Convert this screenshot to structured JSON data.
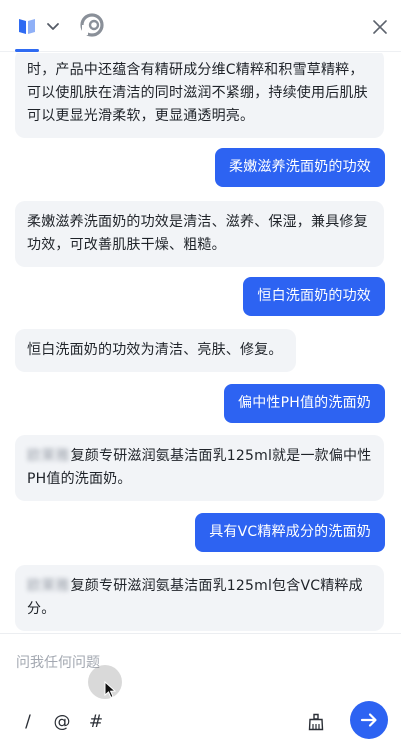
{
  "header": {
    "book_icon": "book-icon",
    "dropdown_icon": "chevron-down-icon",
    "logo_icon": "assistant-logo-icon",
    "close_icon": "close-icon"
  },
  "messages": [
    {
      "role": "assistant",
      "text": "时，产品中还蕴含有精研成分维C精粹和积雪草精粹，可以使肌肤在清洁的同时滋润不紧绷，持续使用后肌肤可以更显光滑柔软，更显通透明亮。"
    },
    {
      "role": "user",
      "text": "柔嫩滋养洗面奶的功效"
    },
    {
      "role": "assistant",
      "text": "柔嫩滋养洗面奶的功效是清洁、滋养、保湿，兼具修复功效，可改善肌肤干燥、粗糙。"
    },
    {
      "role": "user",
      "text": "恒白洗面奶的功效"
    },
    {
      "role": "assistant",
      "text": "恒白洗面奶的功效为清洁、亮肤、修复。"
    },
    {
      "role": "user",
      "text": "偏中性PH值的洗面奶"
    },
    {
      "role": "assistant",
      "brand": "欧莱雅",
      "text": "复颜专研滋润氨基洁面乳125ml就是一款偏中性PH值的洗面奶。"
    },
    {
      "role": "user",
      "text": "具有VC精粹成分的洗面奶"
    },
    {
      "role": "assistant",
      "brand": "欧莱雅",
      "text": "复颜专研滋润氨基洁面乳125ml包含VC精粹成分。"
    }
  ],
  "input": {
    "placeholder": "问我任何问题"
  },
  "toolbar": {
    "slash": "/",
    "at": "@",
    "hash": "#",
    "clear_icon": "clear-broom-icon",
    "send_icon": "send-arrow-icon"
  },
  "colors": {
    "accent": "#2d63f2",
    "bot_bubble": "#f2f4f7"
  }
}
